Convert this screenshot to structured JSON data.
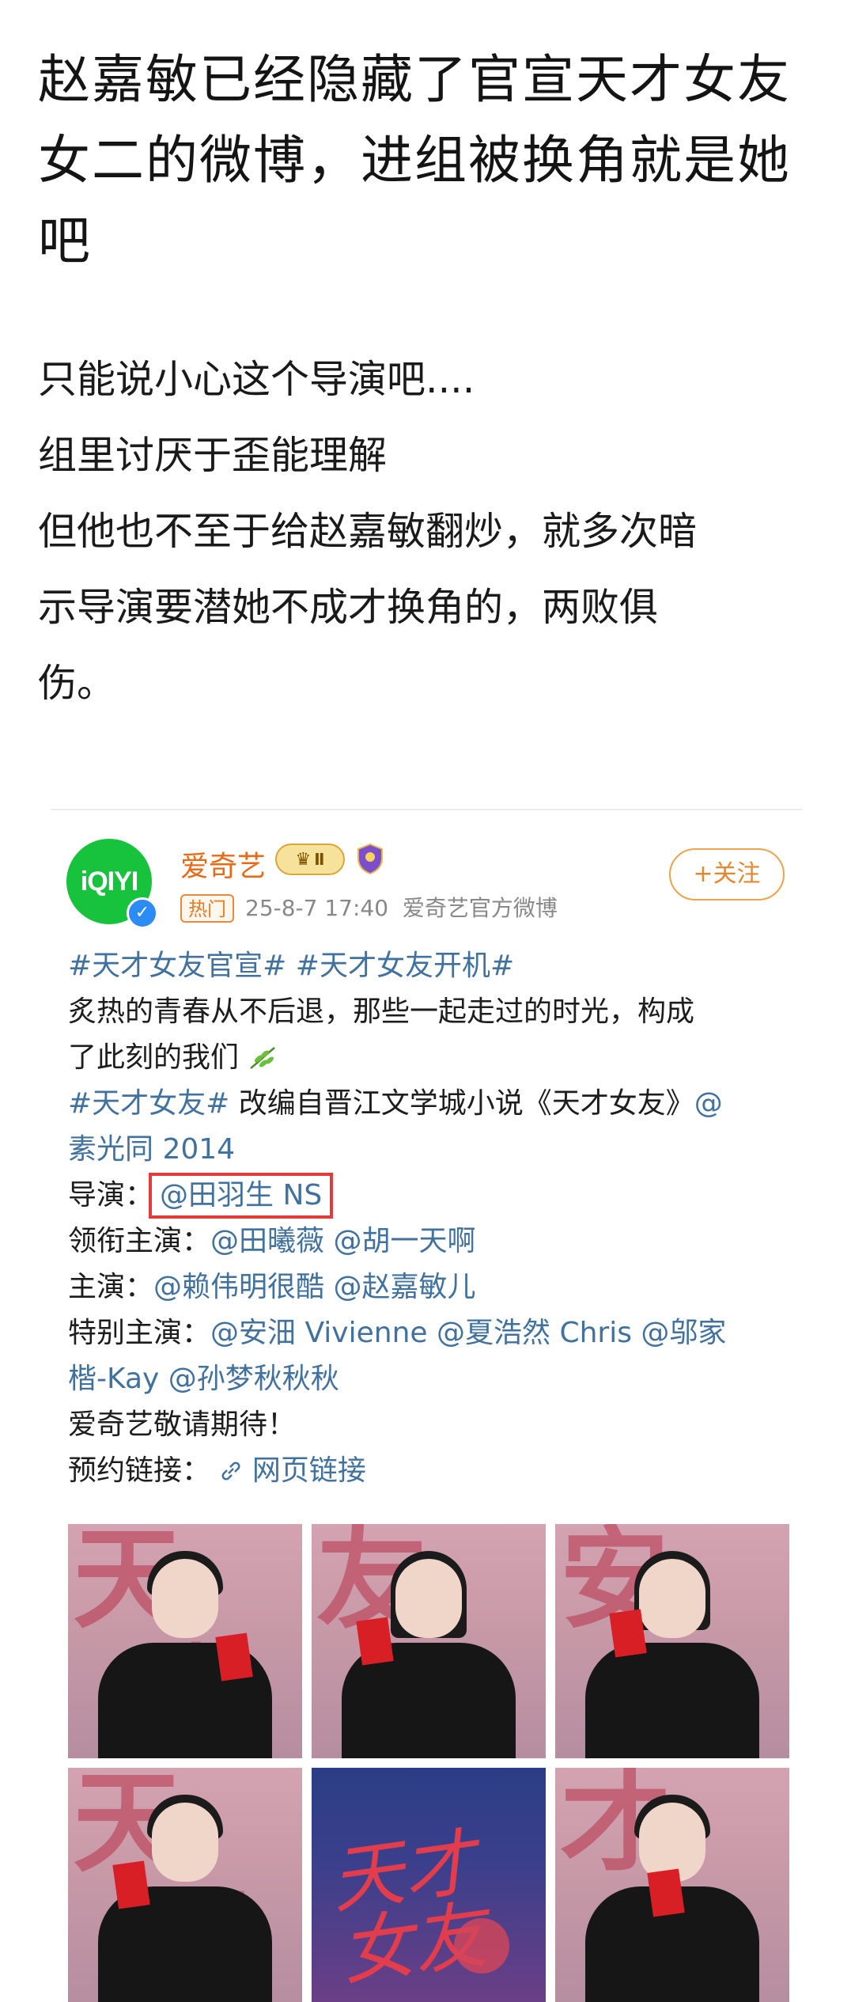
{
  "title": {
    "line1": "赵嘉敏已经隐藏了官宣天才女友",
    "line2": "女二的微博，进组被换角就是她",
    "line3": "吧"
  },
  "body": {
    "line1": "只能说小心这个导演吧....",
    "line2": "组里讨厌于歪能理解",
    "line3": "但他也不至于给赵嘉敏翻炒，就多次暗",
    "line4": "示导演要潜她不成才换角的，两败俱",
    "line5": "伤。"
  },
  "weibo": {
    "avatar_text": "iQIYI",
    "verified_mark": "✓",
    "user_name": "爱奇艺",
    "crown_badge": "Ⅱ",
    "hot_tag": "热门",
    "timestamp": "25-8-7 17:40",
    "source": "爱奇艺官方微博",
    "follow_label": "+关注",
    "post": {
      "hashtag1": "#天才女友官宣#",
      "hashtag2": "#天才女友开机#",
      "text1": "炙热的青春从不后退，那些一起走过的时光，构成",
      "text2": "了此刻的我们",
      "hashtag3": "#天才女友#",
      "text3": " 改编自晋江文学城小说《天才女友》",
      "mention_author_a": "@",
      "mention_author_b": "素光同 2014",
      "director_label": "导演：",
      "director_mention": "@田羽生 NS",
      "lead_label": "领衔主演：",
      "lead1": "@田曦薇",
      "lead2": "@胡一天啊",
      "main_label": "主演：",
      "main1": "@赖伟明很酷",
      "main2": "@赵嘉敏儿",
      "special_label": "特别主演：",
      "special1": "@安沺 Vivienne",
      "special2": "@夏浩然 Chris",
      "special3a": "@邬家",
      "special3b": "楷-Kay",
      "special4": "@孙梦秋秋秋",
      "closing": "爱奇艺敬请期待！",
      "reserve_label": "预约链接：",
      "reserve_link": "网页链接"
    },
    "poster_title": "天才女友"
  },
  "colors": {
    "brand_orange": "#e86a17",
    "link_blue": "#41729f",
    "highlight_red": "#e33b3b",
    "iqiyi_green": "#17c23c"
  }
}
